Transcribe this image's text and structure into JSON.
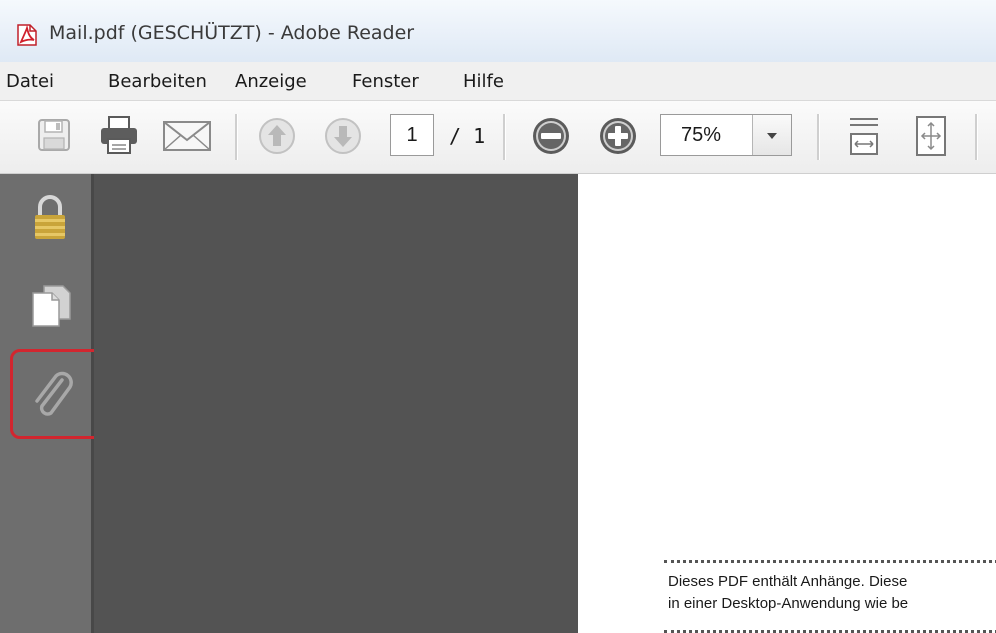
{
  "window": {
    "title": "Mail.pdf (GESCHÜTZT) - Adobe Reader",
    "app_icon": "pdf-icon"
  },
  "menubar": {
    "items": [
      "Datei",
      "Bearbeiten",
      "Anzeige",
      "Fenster",
      "Hilfe"
    ]
  },
  "toolbar": {
    "icons": [
      "save-icon",
      "print-icon",
      "email-icon",
      "previous-page-icon",
      "next-page-icon",
      "zoom-out-icon",
      "zoom-in-icon",
      "fit-width-icon",
      "fit-page-icon"
    ],
    "page_current": "1",
    "page_total": "/ 1",
    "zoom_value": "75%"
  },
  "sidebar": {
    "icons": [
      "lock-icon",
      "pages-icon",
      "paperclip-icon"
    ],
    "highlight_color": "#d2262f"
  },
  "document": {
    "notice_lines": [
      "Dieses PDF enthält Anhänge. Diese",
      "in einer Desktop-Anwendung wie be"
    ]
  },
  "colors": {
    "sidebar": "#6e6e6e",
    "canvas": "#535353",
    "page": "#ffffff",
    "highlight": "#d2262f"
  }
}
